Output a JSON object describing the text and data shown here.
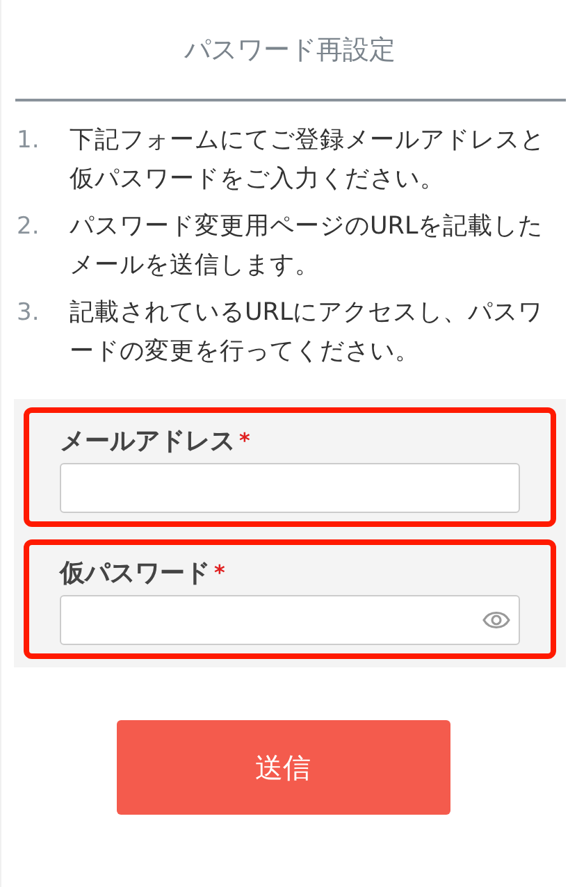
{
  "title": "パスワード再設定",
  "steps": [
    {
      "number": "1.",
      "text": "下記フォームにてご登録メールアドレスと仮パスワードをご入力ください。"
    },
    {
      "number": "2.",
      "text": "パスワード変更用ページのURLを記載したメールを送信します。"
    },
    {
      "number": "3.",
      "text": "記載されているURLにアクセスし、パスワードの変更を行ってください。"
    }
  ],
  "fields": [
    {
      "kind": "email",
      "label": "メールアドレス",
      "required_mark": "*",
      "highlighted": true
    },
    {
      "kind": "password",
      "label": "仮パスワード",
      "required_mark": "*",
      "highlighted": true
    }
  ],
  "submit": "送信"
}
